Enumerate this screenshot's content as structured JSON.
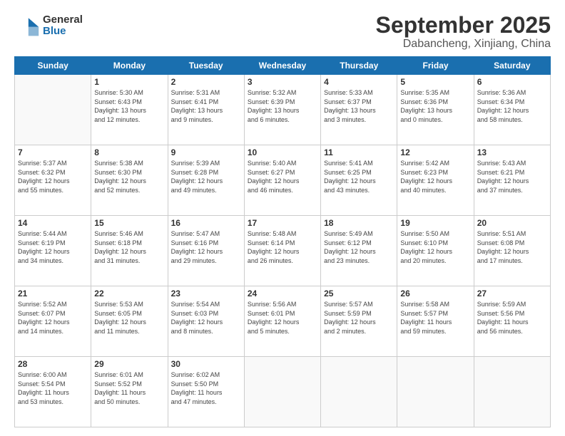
{
  "logo": {
    "general": "General",
    "blue": "Blue"
  },
  "header": {
    "month": "September 2025",
    "location": "Dabancheng, Xinjiang, China"
  },
  "weekdays": [
    "Sunday",
    "Monday",
    "Tuesday",
    "Wednesday",
    "Thursday",
    "Friday",
    "Saturday"
  ],
  "weeks": [
    [
      {
        "day": "",
        "info": ""
      },
      {
        "day": "1",
        "info": "Sunrise: 5:30 AM\nSunset: 6:43 PM\nDaylight: 13 hours\nand 12 minutes."
      },
      {
        "day": "2",
        "info": "Sunrise: 5:31 AM\nSunset: 6:41 PM\nDaylight: 13 hours\nand 9 minutes."
      },
      {
        "day": "3",
        "info": "Sunrise: 5:32 AM\nSunset: 6:39 PM\nDaylight: 13 hours\nand 6 minutes."
      },
      {
        "day": "4",
        "info": "Sunrise: 5:33 AM\nSunset: 6:37 PM\nDaylight: 13 hours\nand 3 minutes."
      },
      {
        "day": "5",
        "info": "Sunrise: 5:35 AM\nSunset: 6:36 PM\nDaylight: 13 hours\nand 0 minutes."
      },
      {
        "day": "6",
        "info": "Sunrise: 5:36 AM\nSunset: 6:34 PM\nDaylight: 12 hours\nand 58 minutes."
      }
    ],
    [
      {
        "day": "7",
        "info": "Sunrise: 5:37 AM\nSunset: 6:32 PM\nDaylight: 12 hours\nand 55 minutes."
      },
      {
        "day": "8",
        "info": "Sunrise: 5:38 AM\nSunset: 6:30 PM\nDaylight: 12 hours\nand 52 minutes."
      },
      {
        "day": "9",
        "info": "Sunrise: 5:39 AM\nSunset: 6:28 PM\nDaylight: 12 hours\nand 49 minutes."
      },
      {
        "day": "10",
        "info": "Sunrise: 5:40 AM\nSunset: 6:27 PM\nDaylight: 12 hours\nand 46 minutes."
      },
      {
        "day": "11",
        "info": "Sunrise: 5:41 AM\nSunset: 6:25 PM\nDaylight: 12 hours\nand 43 minutes."
      },
      {
        "day": "12",
        "info": "Sunrise: 5:42 AM\nSunset: 6:23 PM\nDaylight: 12 hours\nand 40 minutes."
      },
      {
        "day": "13",
        "info": "Sunrise: 5:43 AM\nSunset: 6:21 PM\nDaylight: 12 hours\nand 37 minutes."
      }
    ],
    [
      {
        "day": "14",
        "info": "Sunrise: 5:44 AM\nSunset: 6:19 PM\nDaylight: 12 hours\nand 34 minutes."
      },
      {
        "day": "15",
        "info": "Sunrise: 5:46 AM\nSunset: 6:18 PM\nDaylight: 12 hours\nand 31 minutes."
      },
      {
        "day": "16",
        "info": "Sunrise: 5:47 AM\nSunset: 6:16 PM\nDaylight: 12 hours\nand 29 minutes."
      },
      {
        "day": "17",
        "info": "Sunrise: 5:48 AM\nSunset: 6:14 PM\nDaylight: 12 hours\nand 26 minutes."
      },
      {
        "day": "18",
        "info": "Sunrise: 5:49 AM\nSunset: 6:12 PM\nDaylight: 12 hours\nand 23 minutes."
      },
      {
        "day": "19",
        "info": "Sunrise: 5:50 AM\nSunset: 6:10 PM\nDaylight: 12 hours\nand 20 minutes."
      },
      {
        "day": "20",
        "info": "Sunrise: 5:51 AM\nSunset: 6:08 PM\nDaylight: 12 hours\nand 17 minutes."
      }
    ],
    [
      {
        "day": "21",
        "info": "Sunrise: 5:52 AM\nSunset: 6:07 PM\nDaylight: 12 hours\nand 14 minutes."
      },
      {
        "day": "22",
        "info": "Sunrise: 5:53 AM\nSunset: 6:05 PM\nDaylight: 12 hours\nand 11 minutes."
      },
      {
        "day": "23",
        "info": "Sunrise: 5:54 AM\nSunset: 6:03 PM\nDaylight: 12 hours\nand 8 minutes."
      },
      {
        "day": "24",
        "info": "Sunrise: 5:56 AM\nSunset: 6:01 PM\nDaylight: 12 hours\nand 5 minutes."
      },
      {
        "day": "25",
        "info": "Sunrise: 5:57 AM\nSunset: 5:59 PM\nDaylight: 12 hours\nand 2 minutes."
      },
      {
        "day": "26",
        "info": "Sunrise: 5:58 AM\nSunset: 5:57 PM\nDaylight: 11 hours\nand 59 minutes."
      },
      {
        "day": "27",
        "info": "Sunrise: 5:59 AM\nSunset: 5:56 PM\nDaylight: 11 hours\nand 56 minutes."
      }
    ],
    [
      {
        "day": "28",
        "info": "Sunrise: 6:00 AM\nSunset: 5:54 PM\nDaylight: 11 hours\nand 53 minutes."
      },
      {
        "day": "29",
        "info": "Sunrise: 6:01 AM\nSunset: 5:52 PM\nDaylight: 11 hours\nand 50 minutes."
      },
      {
        "day": "30",
        "info": "Sunrise: 6:02 AM\nSunset: 5:50 PM\nDaylight: 11 hours\nand 47 minutes."
      },
      {
        "day": "",
        "info": ""
      },
      {
        "day": "",
        "info": ""
      },
      {
        "day": "",
        "info": ""
      },
      {
        "day": "",
        "info": ""
      }
    ]
  ]
}
